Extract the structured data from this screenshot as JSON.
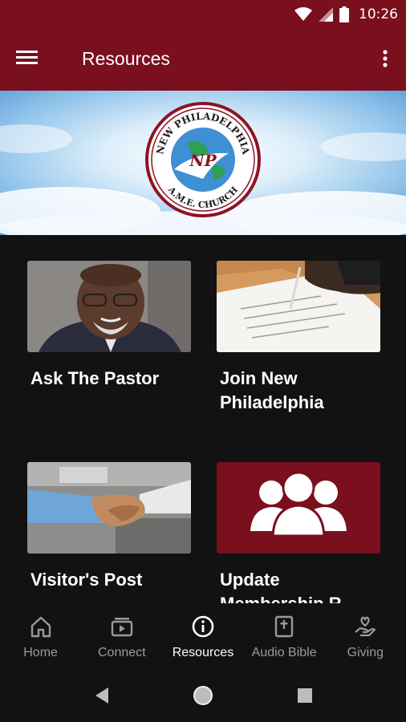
{
  "status_bar": {
    "time": "10:26",
    "icons": [
      "wifi-icon",
      "signal-icon",
      "battery-icon"
    ]
  },
  "app_bar": {
    "title": "Resources",
    "menu_icon": "hamburger-menu-icon",
    "overflow_icon": "more-vertical-icon",
    "background": "#7a0f1e"
  },
  "banner": {
    "logo_top_text": "NEW PHILADELPHIA",
    "logo_bottom_text": "A.M.E. CHURCH",
    "logo_monogram": "NP"
  },
  "resources": [
    {
      "label": "Ask The Pastor"
    },
    {
      "label_line1": "Join New",
      "label_line2": "Philadelphia"
    },
    {
      "label": "Visitor's Post"
    },
    {
      "label": "Update Membership R"
    }
  ],
  "bottom_nav": {
    "items": [
      {
        "label": "Home",
        "icon": "home-icon"
      },
      {
        "label": "Connect",
        "icon": "video-icon"
      },
      {
        "label": "Resources",
        "icon": "info-icon",
        "active": true
      },
      {
        "label": "Audio Bible",
        "icon": "bible-icon"
      },
      {
        "label": "Giving",
        "icon": "giving-hand-icon"
      }
    ]
  },
  "colors": {
    "brand": "#7a0f1e",
    "background": "#121212",
    "inactive": "#9a9a9a",
    "active": "#ffffff"
  }
}
